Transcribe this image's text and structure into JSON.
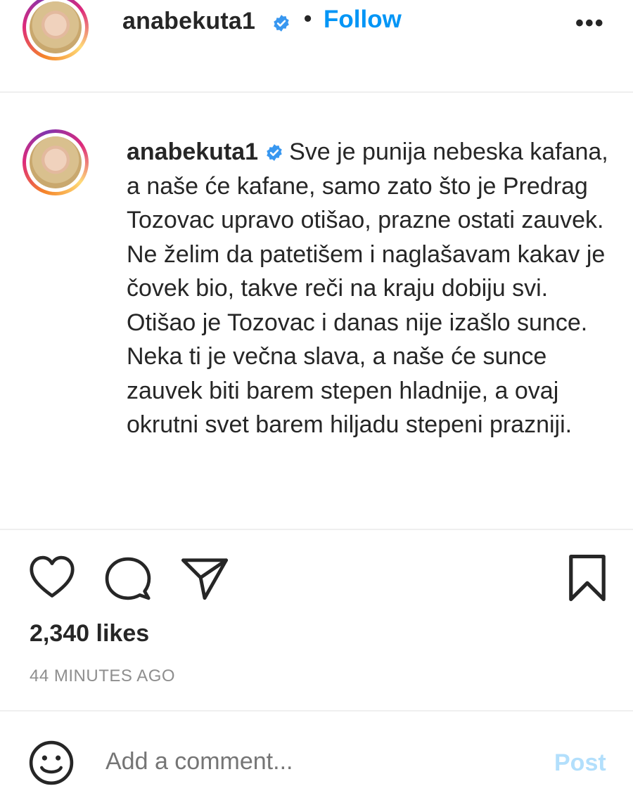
{
  "header": {
    "username": "anabekuta1",
    "separator": "•",
    "follow_label": "Follow",
    "more_label": "•••"
  },
  "caption": {
    "username": "anabekuta1",
    "text": "Sve je punija nebeska kafana, a naše će kafane, samo zato što je Predrag Tozovac upravo otišao, prazne ostati zauvek. Ne želim da patetišem i naglašavam kakav je čovek bio, takve reči na kraju dobiju svi. Otišao je Tozovac i danas nije izašlo sunce. Neka ti je večna slava, a naše će sunce zauvek biti barem stepen hladnije, a ovaj okrutni svet barem hiljadu stepeni prazniji."
  },
  "actions": {
    "like_icon": "heart-icon",
    "comment_icon": "comment-icon",
    "share_icon": "paper-plane-icon",
    "save_icon": "bookmark-icon"
  },
  "likes": "2,340 likes",
  "timestamp": "44 MINUTES AGO",
  "comment": {
    "emoji_icon": "emoji-icon",
    "placeholder": "Add a comment...",
    "post_label": "Post"
  },
  "colors": {
    "accent": "#0095f6",
    "post_disabled": "#b2dffc",
    "text": "#262626",
    "muted": "#8e8e8e"
  }
}
